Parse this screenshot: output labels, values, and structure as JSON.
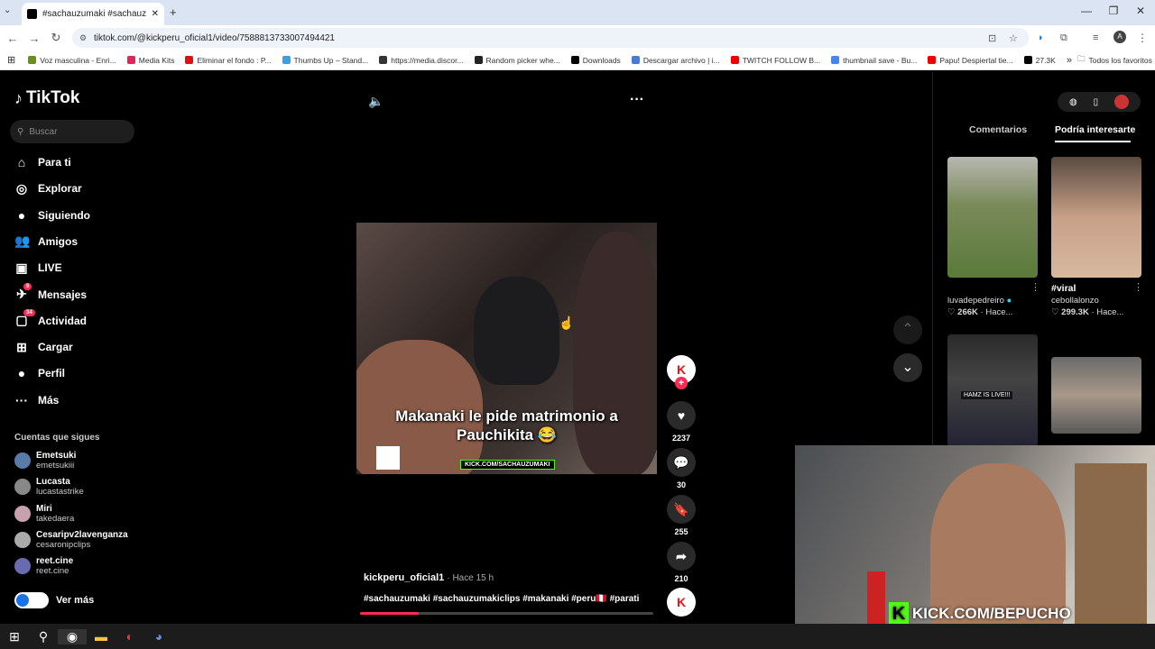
{
  "browser": {
    "tab_title": "#sachauzumaki #sachauzumaki",
    "url": "tiktok.com/@kickperu_oficial1/video/7588813733007494421",
    "bookmarks": [
      {
        "label": "Voz masculina - Enri...",
        "color": "#6b8e23"
      },
      {
        "label": "Media Kits",
        "color": "#e0245e"
      },
      {
        "label": "Eliminar el fondo : P...",
        "color": "#d11"
      },
      {
        "label": "Thumbs Up – Stand...",
        "color": "#3aa0e0"
      },
      {
        "label": "https://media.discor...",
        "color": "#333"
      },
      {
        "label": "Random picker whe...",
        "color": "#222"
      },
      {
        "label": "Downloads",
        "color": "#000"
      },
      {
        "label": "Descargar archivo | i...",
        "color": "#4a7bd4"
      },
      {
        "label": "TWITCH FOLLOW B...",
        "color": "#e00"
      },
      {
        "label": "thumbnail save - Bu...",
        "color": "#4285f4"
      },
      {
        "label": "Papu! Despiertal tie...",
        "color": "#e00"
      },
      {
        "label": "27.3K",
        "color": "#000"
      }
    ],
    "all_favorites": "Todos los favoritos"
  },
  "sidebar": {
    "logo": "TikTok",
    "search_placeholder": "Buscar",
    "nav": [
      {
        "label": "Para ti",
        "icon": "home-icon",
        "glyph": "⌂"
      },
      {
        "label": "Explorar",
        "icon": "compass-icon",
        "glyph": "◎"
      },
      {
        "label": "Siguiendo",
        "icon": "following-avatar-icon",
        "glyph": "●"
      },
      {
        "label": "Amigos",
        "icon": "friends-icon",
        "glyph": "👥"
      },
      {
        "label": "LIVE",
        "icon": "live-icon",
        "glyph": "▣"
      },
      {
        "label": "Mensajes",
        "icon": "messages-icon",
        "glyph": "✈",
        "badge": "9"
      },
      {
        "label": "Actividad",
        "icon": "activity-icon",
        "glyph": "▢",
        "badge": "34"
      },
      {
        "label": "Cargar",
        "icon": "upload-icon",
        "glyph": "⊞"
      },
      {
        "label": "Perfil",
        "icon": "profile-icon",
        "glyph": "●"
      },
      {
        "label": "Más",
        "icon": "more-icon",
        "glyph": "···"
      }
    ],
    "following_header": "Cuentas que sigues",
    "accounts": [
      {
        "name": "Emetsuki",
        "handle": "emetsukiii",
        "color": "#5a7aa8"
      },
      {
        "name": "Lucasta",
        "handle": "lucastastrike",
        "color": "#888"
      },
      {
        "name": "Miri",
        "handle": "takedaera",
        "color": "#c8a0b0"
      },
      {
        "name": "Cesaripv2lavenganza",
        "handle": "cesaronipclips",
        "color": "#aaa"
      },
      {
        "name": "reet.cine",
        "handle": "reet.cine",
        "color": "#6a6ab0"
      }
    ],
    "see_more": "Ver más"
  },
  "video": {
    "caption_line1": "Makanaki le pide matrimonio a",
    "caption_line2": "Pauchikita 😂",
    "watermark": "KICK.COM/SACHAUZUMAKI",
    "author": "kickperu_oficial1",
    "time": "· Hace 15 h",
    "hashtags": "#sachauzumaki #sachauzumakiclips #makanaki #peru🇵🇪 #parati",
    "progress": 0.2
  },
  "actions": {
    "likes": "2237",
    "comments": "30",
    "saves": "255",
    "shares": "210"
  },
  "right_panel": {
    "tab_comments": "Comentarios",
    "tab_suggested": "Podría interesarte",
    "cards": [
      {
        "title": "",
        "user": "luvadepedreiro",
        "likes": "266K",
        "time": "Hace..."
      },
      {
        "title": "#viral",
        "user": "cebollalonzo",
        "likes": "299.3K",
        "time": "Hace..."
      },
      {
        "title": "",
        "user": "",
        "likes": "",
        "time": "",
        "overlay": "HAMZ IS LIVE!!!"
      },
      {
        "title": "",
        "user": "",
        "likes": "",
        "time": ""
      }
    ]
  },
  "webcam": {
    "overlay_text": "KICK.COM/BEPUCHO"
  }
}
